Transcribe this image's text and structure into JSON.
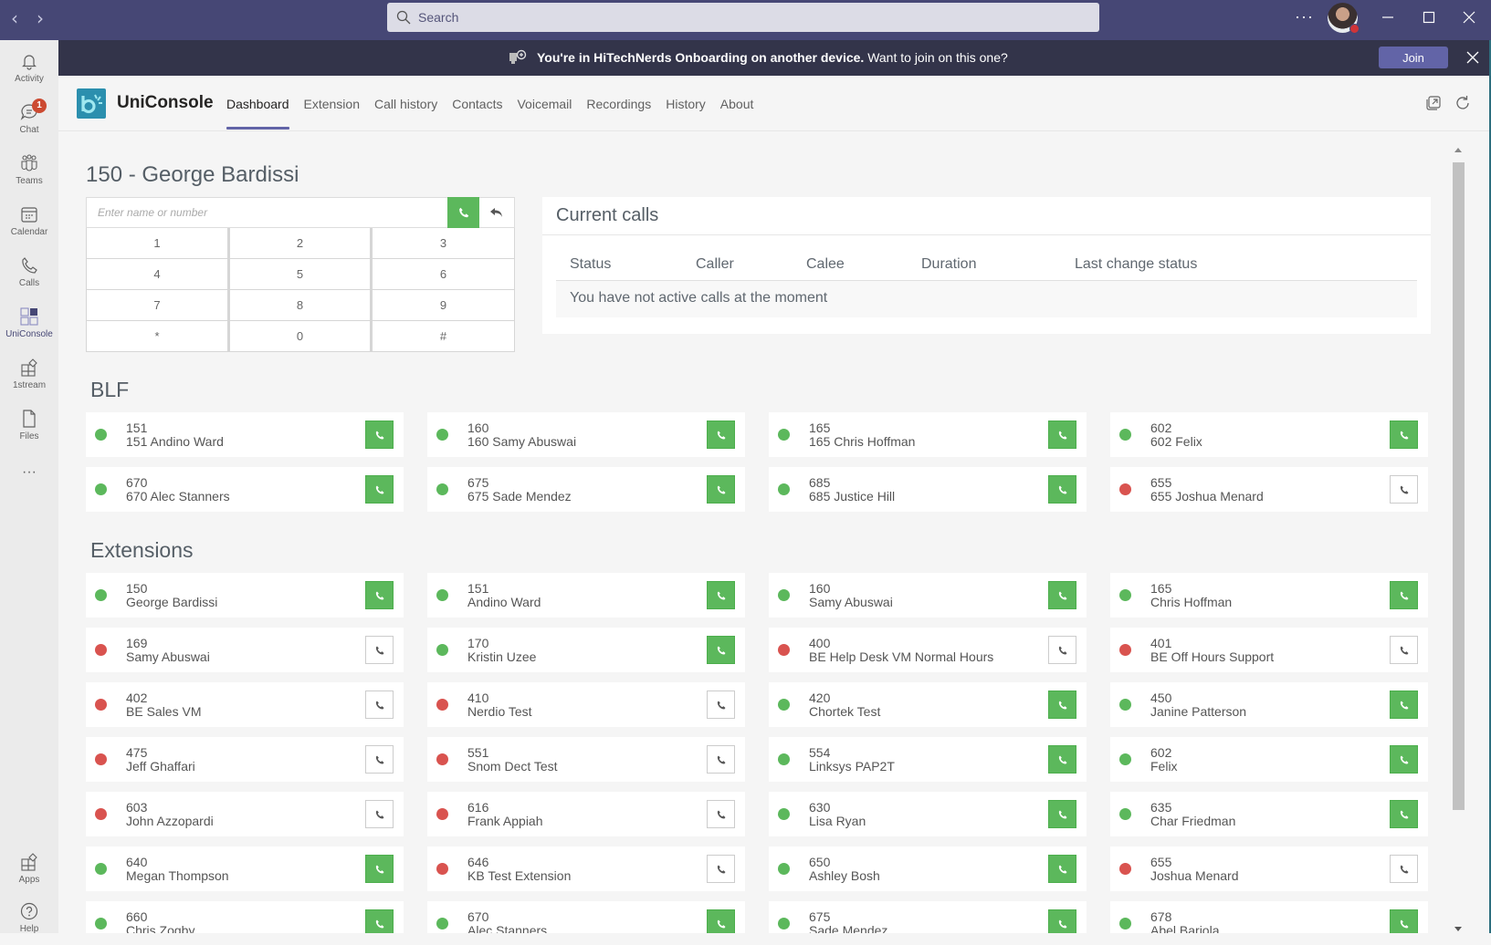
{
  "titlebar": {
    "search_placeholder": "Search",
    "more_label": "···"
  },
  "rail": {
    "items": [
      {
        "label": "Activity",
        "icon": "bell-icon"
      },
      {
        "label": "Chat",
        "icon": "chat-icon",
        "badge": "1"
      },
      {
        "label": "Teams",
        "icon": "teams-icon"
      },
      {
        "label": "Calendar",
        "icon": "calendar-icon"
      },
      {
        "label": "Calls",
        "icon": "phone-icon"
      },
      {
        "label": "UniConsole",
        "icon": "uniconsole-icon",
        "active": true
      },
      {
        "label": "1stream",
        "icon": "app-grid-icon"
      },
      {
        "label": "Files",
        "icon": "file-icon"
      },
      {
        "label": "···",
        "icon": "more-icon"
      }
    ],
    "bottom": [
      {
        "label": "Apps",
        "icon": "apps-icon"
      },
      {
        "label": "Help",
        "icon": "help-icon"
      }
    ]
  },
  "banner": {
    "bold": "You're in HiTechNerds Onboarding on another device.",
    "rest": " Want to join on this one?",
    "join_label": "Join"
  },
  "app": {
    "name": "UniConsole",
    "tabs": [
      "Dashboard",
      "Extension",
      "Call history",
      "Contacts",
      "Voicemail",
      "Recordings",
      "History",
      "About"
    ],
    "active_tab": "Dashboard"
  },
  "dashboard": {
    "extension_title": "150 - George Bardissi",
    "dial_placeholder": "Enter name or number",
    "keypad": [
      "1",
      "2",
      "3",
      "4",
      "5",
      "6",
      "7",
      "8",
      "9",
      "*",
      "0",
      "#"
    ],
    "current_calls": {
      "title": "Current calls",
      "columns": [
        "Status",
        "Caller",
        "Calee",
        "Duration",
        "Last change status"
      ],
      "empty_message": "You have not active calls at the moment"
    },
    "blf_title": "BLF",
    "blf": [
      {
        "number": "151",
        "name": "151 Andino Ward",
        "status": "available"
      },
      {
        "number": "160",
        "name": "160 Samy Abuswai",
        "status": "available"
      },
      {
        "number": "165",
        "name": "165 Chris Hoffman",
        "status": "available"
      },
      {
        "number": "602",
        "name": "602 Felix",
        "status": "available"
      },
      {
        "number": "670",
        "name": "670 Alec Stanners",
        "status": "available"
      },
      {
        "number": "675",
        "name": "675 Sade Mendez",
        "status": "available"
      },
      {
        "number": "685",
        "name": "685 Justice Hill",
        "status": "available"
      },
      {
        "number": "655",
        "name": "655 Joshua Menard",
        "status": "unavailable"
      }
    ],
    "extensions_title": "Extensions",
    "extensions": [
      {
        "number": "150",
        "name": "George Bardissi",
        "status": "available"
      },
      {
        "number": "151",
        "name": "Andino Ward",
        "status": "available"
      },
      {
        "number": "160",
        "name": "Samy Abuswai",
        "status": "available"
      },
      {
        "number": "165",
        "name": "Chris Hoffman",
        "status": "available"
      },
      {
        "number": "169",
        "name": "Samy Abuswai",
        "status": "unavailable"
      },
      {
        "number": "170",
        "name": "Kristin Uzee",
        "status": "available"
      },
      {
        "number": "400",
        "name": "BE Help Desk VM Normal Hours",
        "status": "unavailable"
      },
      {
        "number": "401",
        "name": "BE Off Hours Support",
        "status": "unavailable"
      },
      {
        "number": "402",
        "name": "BE Sales VM",
        "status": "unavailable"
      },
      {
        "number": "410",
        "name": "Nerdio Test",
        "status": "unavailable"
      },
      {
        "number": "420",
        "name": "Chortek Test",
        "status": "available"
      },
      {
        "number": "450",
        "name": "Janine Patterson",
        "status": "available"
      },
      {
        "number": "475",
        "name": "Jeff Ghaffari",
        "status": "unavailable"
      },
      {
        "number": "551",
        "name": "Snom Dect Test",
        "status": "unavailable"
      },
      {
        "number": "554",
        "name": "Linksys PAP2T",
        "status": "available"
      },
      {
        "number": "602",
        "name": "Felix",
        "status": "available"
      },
      {
        "number": "603",
        "name": "John Azzopardi",
        "status": "unavailable"
      },
      {
        "number": "616",
        "name": "Frank Appiah",
        "status": "unavailable"
      },
      {
        "number": "630",
        "name": "Lisa Ryan",
        "status": "available"
      },
      {
        "number": "635",
        "name": "Char Friedman",
        "status": "available"
      },
      {
        "number": "640",
        "name": "Megan Thompson",
        "status": "available"
      },
      {
        "number": "646",
        "name": "KB Test Extension",
        "status": "unavailable"
      },
      {
        "number": "650",
        "name": "Ashley Bosh",
        "status": "available"
      },
      {
        "number": "655",
        "name": "Joshua Menard",
        "status": "unavailable"
      },
      {
        "number": "660",
        "name": "Chris Zogby",
        "status": "available"
      },
      {
        "number": "670",
        "name": "Alec Stanners",
        "status": "available"
      },
      {
        "number": "675",
        "name": "Sade Mendez",
        "status": "available"
      },
      {
        "number": "678",
        "name": "Abel Bariola",
        "status": "available"
      }
    ]
  },
  "colors": {
    "titlebar": "#464775",
    "banner": "#33344a",
    "accent": "#6264a7",
    "available": "#5cb85c",
    "unavailable": "#d9534f",
    "logo": "#2b8fae"
  }
}
